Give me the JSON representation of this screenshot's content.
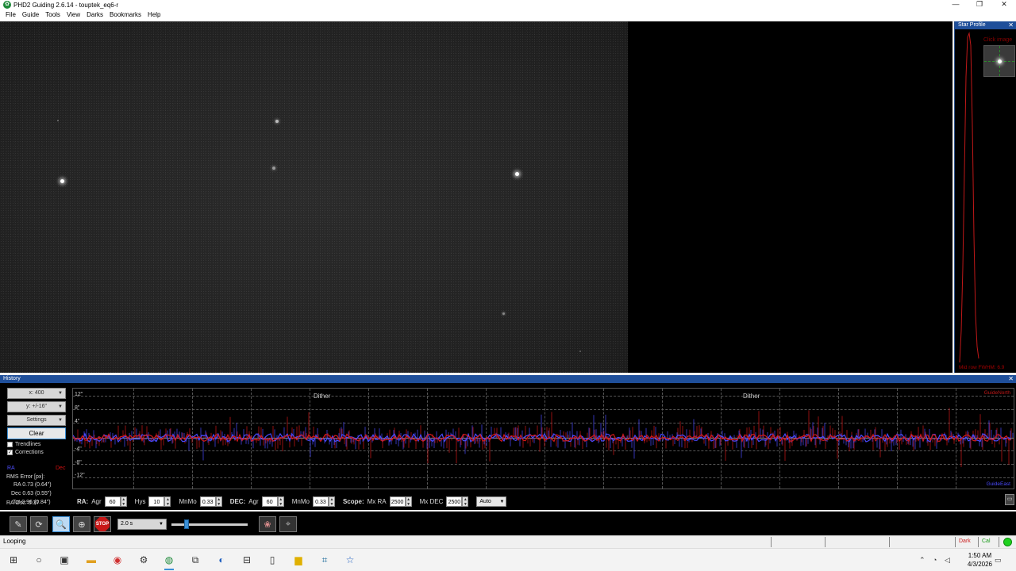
{
  "window": {
    "title": "PHD2 Guiding 2.6.14 - touptek_eq6-r",
    "app_icon": "phd2-icon",
    "minimize": "—",
    "restore": "❐",
    "close": "✕"
  },
  "menu": [
    "File",
    "Guide",
    "Tools",
    "View",
    "Darks",
    "Bookmarks",
    "Help"
  ],
  "star_profile": {
    "title": "Star Profile",
    "close": "✕",
    "hint": "Click image",
    "footer": "Mid row FWHM: 6.9"
  },
  "history": {
    "title": "History",
    "close": "✕",
    "x_scale": "x: 400",
    "y_scale": "y: +/-16\"",
    "settings": "Settings",
    "clear": "Clear",
    "trendlines": "Trendlines",
    "trendlines_checked": false,
    "corrections": "Corrections",
    "corrections_checked": true,
    "legend_ra": "RA",
    "legend_dec": "Dec",
    "rms_title": "RMS Error [px]:",
    "rms_ra": "RA 0.73 (0.64\")",
    "rms_dec": "Dec 0.63 (0.55\")",
    "rms_tot": "Tot 0.96 (0.84\")",
    "ra_osc": "RA Osc: 0.37",
    "y_labels": [
      "12\"",
      "8\"",
      "4\"",
      "-4\"",
      "-8\"",
      "-12\""
    ],
    "dither_labels": [
      "Dither",
      "Dither"
    ],
    "guide_north": "GuideNorth",
    "guide_east": "GuideEast",
    "colors": {
      "ra": "#4a4aff",
      "dec": "#d01818"
    }
  },
  "algo": {
    "ra_label": "RA:",
    "ra_agr_label": "Agr",
    "ra_agr": "60",
    "hys_label": "Hys",
    "hys": "10",
    "mnmo_label": "MnMo",
    "ra_mnmo": "0.33",
    "dec_label": "DEC:",
    "dec_agr_label": "Agr",
    "dec_agr": "60",
    "dec_mnmo_label": "MnMo",
    "dec_mnmo": "0.33",
    "scope_label": "Scope:",
    "mx_ra_label": "Mx RA",
    "mx_ra": "2500",
    "mx_dec_label": "Mx DEC",
    "mx_dec": "2500",
    "dec_mode": "Auto"
  },
  "toolbar": {
    "exposure": "2.0 s",
    "stop": "STOP",
    "icons": [
      "usb-connect-icon",
      "loop-icon",
      "auto-select-star-icon",
      "guide-target-icon",
      "stop-icon",
      "brain-icon",
      "scope-icon"
    ]
  },
  "status": {
    "text": "Looping",
    "dark": "Dark",
    "cal": "Cal"
  },
  "taskbar": {
    "time": "1:50 AM",
    "date": "4/3/2026"
  }
}
